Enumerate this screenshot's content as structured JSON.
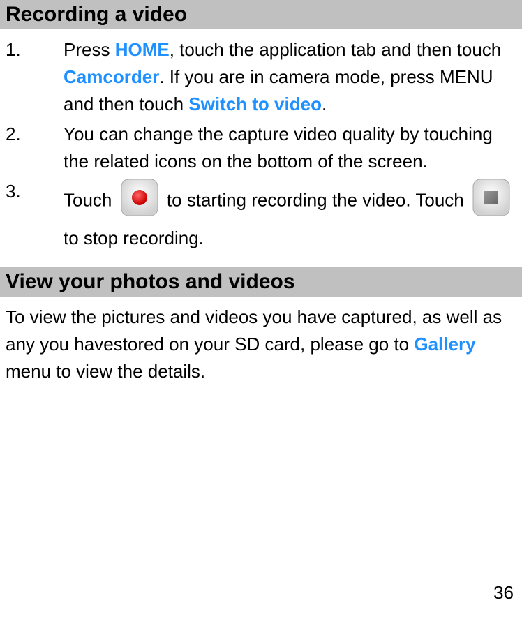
{
  "sections": {
    "recording": {
      "title": "Recording a video",
      "items": {
        "item1": {
          "number": "1.",
          "part1": "Press ",
          "home": "HOME",
          "part2": ", touch the application tab and then touch ",
          "camcorder": "Camcorder",
          "part3": ". If you are in camera mode, press MENU and then touch ",
          "switch": "Switch to video",
          "part4": "."
        },
        "item2": {
          "number": "2.",
          "text": "You can change the capture video quality by touching the related icons on the bottom of the screen."
        },
        "item3": {
          "number": "3.",
          "part1": "Touch ",
          "part2": "to starting recording the video. Touch",
          "part3": " to stop recording."
        }
      }
    },
    "view": {
      "title": "View your photos and videos",
      "body": {
        "part1": "To view the pictures and videos you have captured, as well as any you havestored on your SD card, please go to ",
        "gallery": "Gallery",
        "part2": " menu to view the details."
      }
    }
  },
  "page_number": "36"
}
